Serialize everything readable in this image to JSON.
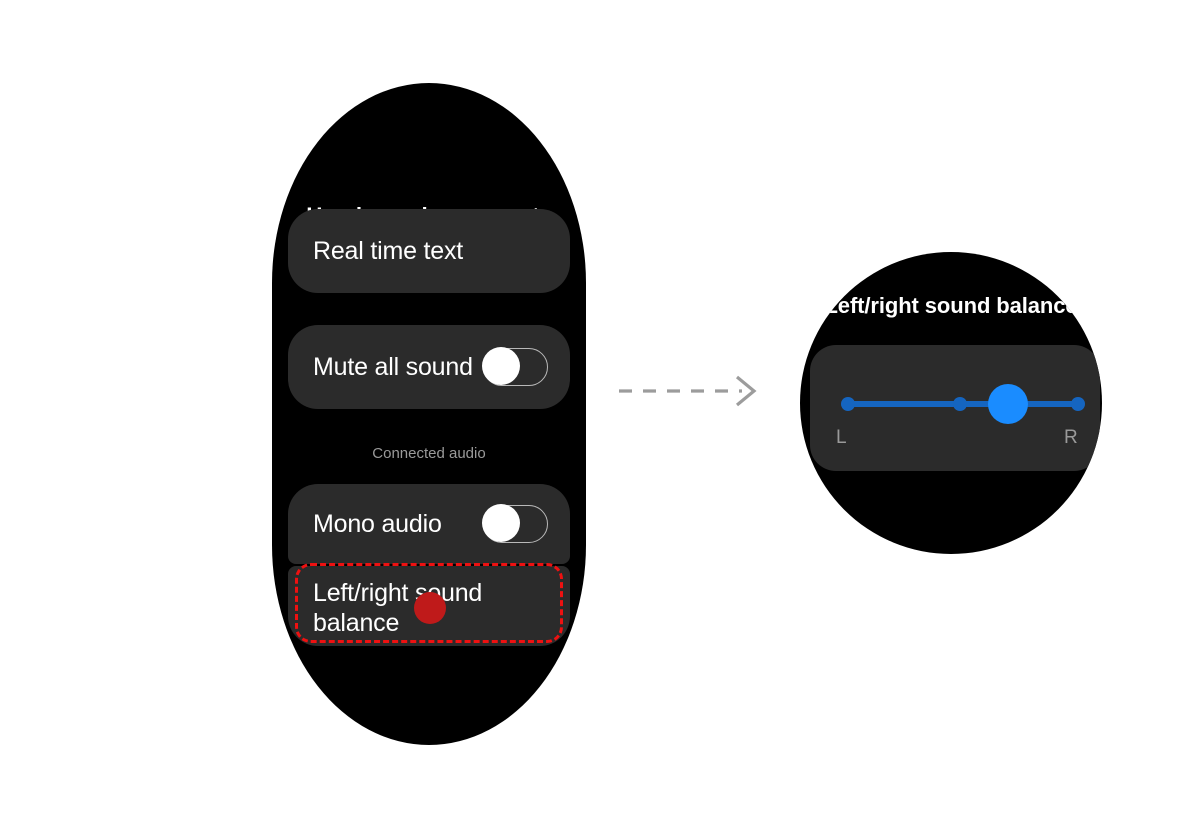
{
  "left_device": {
    "name": "wear-os-hearing-enhancements-screen",
    "title": "Hearing enhencements",
    "items": [
      {
        "label": "Real time text",
        "type": "row"
      },
      {
        "label": "Mute all sound",
        "type": "toggle-row",
        "toggle_state": "off"
      }
    ],
    "section_header": "Connected audio",
    "connected_audio_items": [
      {
        "label": "Mono audio",
        "type": "toggle-row",
        "toggle_state": "off"
      },
      {
        "label": "Left/right sound balance",
        "type": "row",
        "highlighted": "true"
      }
    ]
  },
  "annotation": {
    "highlight_color": "#ee1111",
    "tap_dot_color": "#bf1a1a",
    "arrow_color": "#9c9c9c",
    "arrow_style": "dashed-right-arrow"
  },
  "right_device": {
    "name": "left-right-sound-balance-screen",
    "title": "Left/right sound balance",
    "slider": {
      "label_left": "L",
      "label_right": "R",
      "value_percent": 65,
      "min": 0,
      "max": 100,
      "track_color": "#1565c0",
      "thumb_color": "#1a8cff",
      "tick_positions_percent": [
        0,
        48,
        100
      ]
    }
  },
  "theme": {
    "background": "#ffffff",
    "device_background": "#000000",
    "card_background": "#2b2b2b",
    "primary_text": "#ffffff",
    "secondary_text": "#9a9a9a"
  }
}
